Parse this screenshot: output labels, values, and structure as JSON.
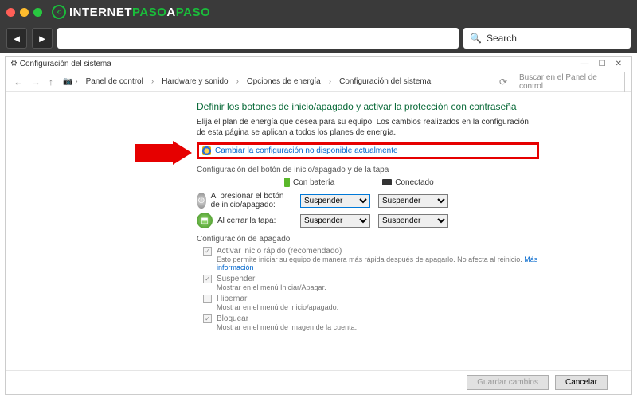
{
  "browser": {
    "logo_text_a": "INTERNET",
    "logo_text_b": "PASO",
    "logo_text_c": "A",
    "logo_text_d": "PASO",
    "search_placeholder": "Search"
  },
  "window": {
    "title": "Configuración del sistema",
    "breadcrumb": {
      "root": "Panel de control",
      "l1": "Hardware y sonido",
      "l2": "Opciones de energía",
      "l3": "Configuración del sistema"
    },
    "search_placeholder": "Buscar en el Panel de control"
  },
  "page": {
    "heading": "Definir los botones de inicio/apagado y activar la protección con contraseña",
    "description": "Elija el plan de energía que desea para su equipo. Los cambios realizados en la configuración de esta página se aplican a todos los planes de energía.",
    "change_link": "Cambiar la configuración no disponible actualmente",
    "section_buttons": "Configuración del botón de inicio/apagado y de la tapa",
    "col_battery": "Con batería",
    "col_plugged": "Conectado",
    "row_power": "Al presionar el botón de inicio/apagado:",
    "row_lid": "Al cerrar la tapa:",
    "option_suspend": "Suspender",
    "section_shutdown": "Configuración de apagado",
    "fast_startup": "Activar inicio rápido (recomendado)",
    "fast_startup_sub_a": "Esto permite iniciar su equipo de manera más rápida después de apagarlo. No afecta al reinicio. ",
    "more_info": "Más información",
    "suspend": "Suspender",
    "suspend_sub": "Mostrar en el menú Iniciar/Apagar.",
    "hibernate": "Hibernar",
    "hibernate_sub": "Mostrar en el menú de inicio/apagado.",
    "lock": "Bloquear",
    "lock_sub": "Mostrar en el menú de imagen de la cuenta."
  },
  "footer": {
    "save": "Guardar cambios",
    "cancel": "Cancelar"
  }
}
